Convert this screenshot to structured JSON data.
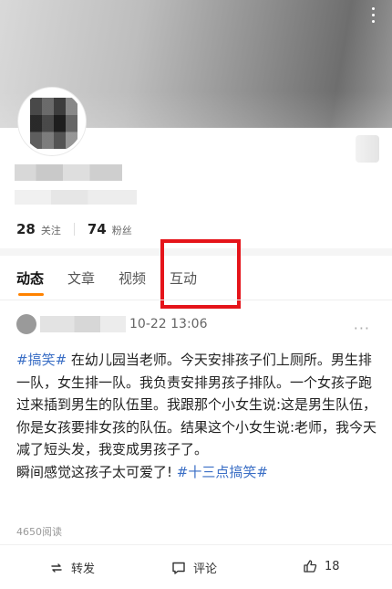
{
  "profile": {
    "following_count": "28",
    "following_label": "关注",
    "followers_count": "74",
    "followers_label": "粉丝"
  },
  "tabs": [
    {
      "label": "动态",
      "active": true
    },
    {
      "label": "文章",
      "active": false
    },
    {
      "label": "视频",
      "active": false
    },
    {
      "label": "互动",
      "active": false
    }
  ],
  "post": {
    "time": "10-22 13:06",
    "tag_start": "#搞笑#",
    "text": " 在幼儿园当老师。今天安排孩子们上厕所。男生排一队，女生排一队。我负责安排男孩子排队。一个女孩子跑过来插到男生的队伍里。我跟那个小女生说:这是男生队伍，你是女孩要排女孩的队伍。结果这个小女生说:老师，我今天减了短头发，我变成男孩子了。",
    "text2": "瞬间感觉这孩子太可爱了! ",
    "tag_end": "#十三点搞笑#",
    "reads": "4650阅读"
  },
  "actions": {
    "repost": "转发",
    "comment": "评论",
    "like_count": "18"
  },
  "icons": {
    "more_top": "more-vertical-icon",
    "more_post": "more-horizontal-icon",
    "repost": "repost-icon",
    "comment": "comment-icon",
    "like": "thumbs-up-icon"
  },
  "colors": {
    "accent": "#ff8200",
    "tag": "#3a6ec5",
    "highlight": "#e5141a"
  }
}
